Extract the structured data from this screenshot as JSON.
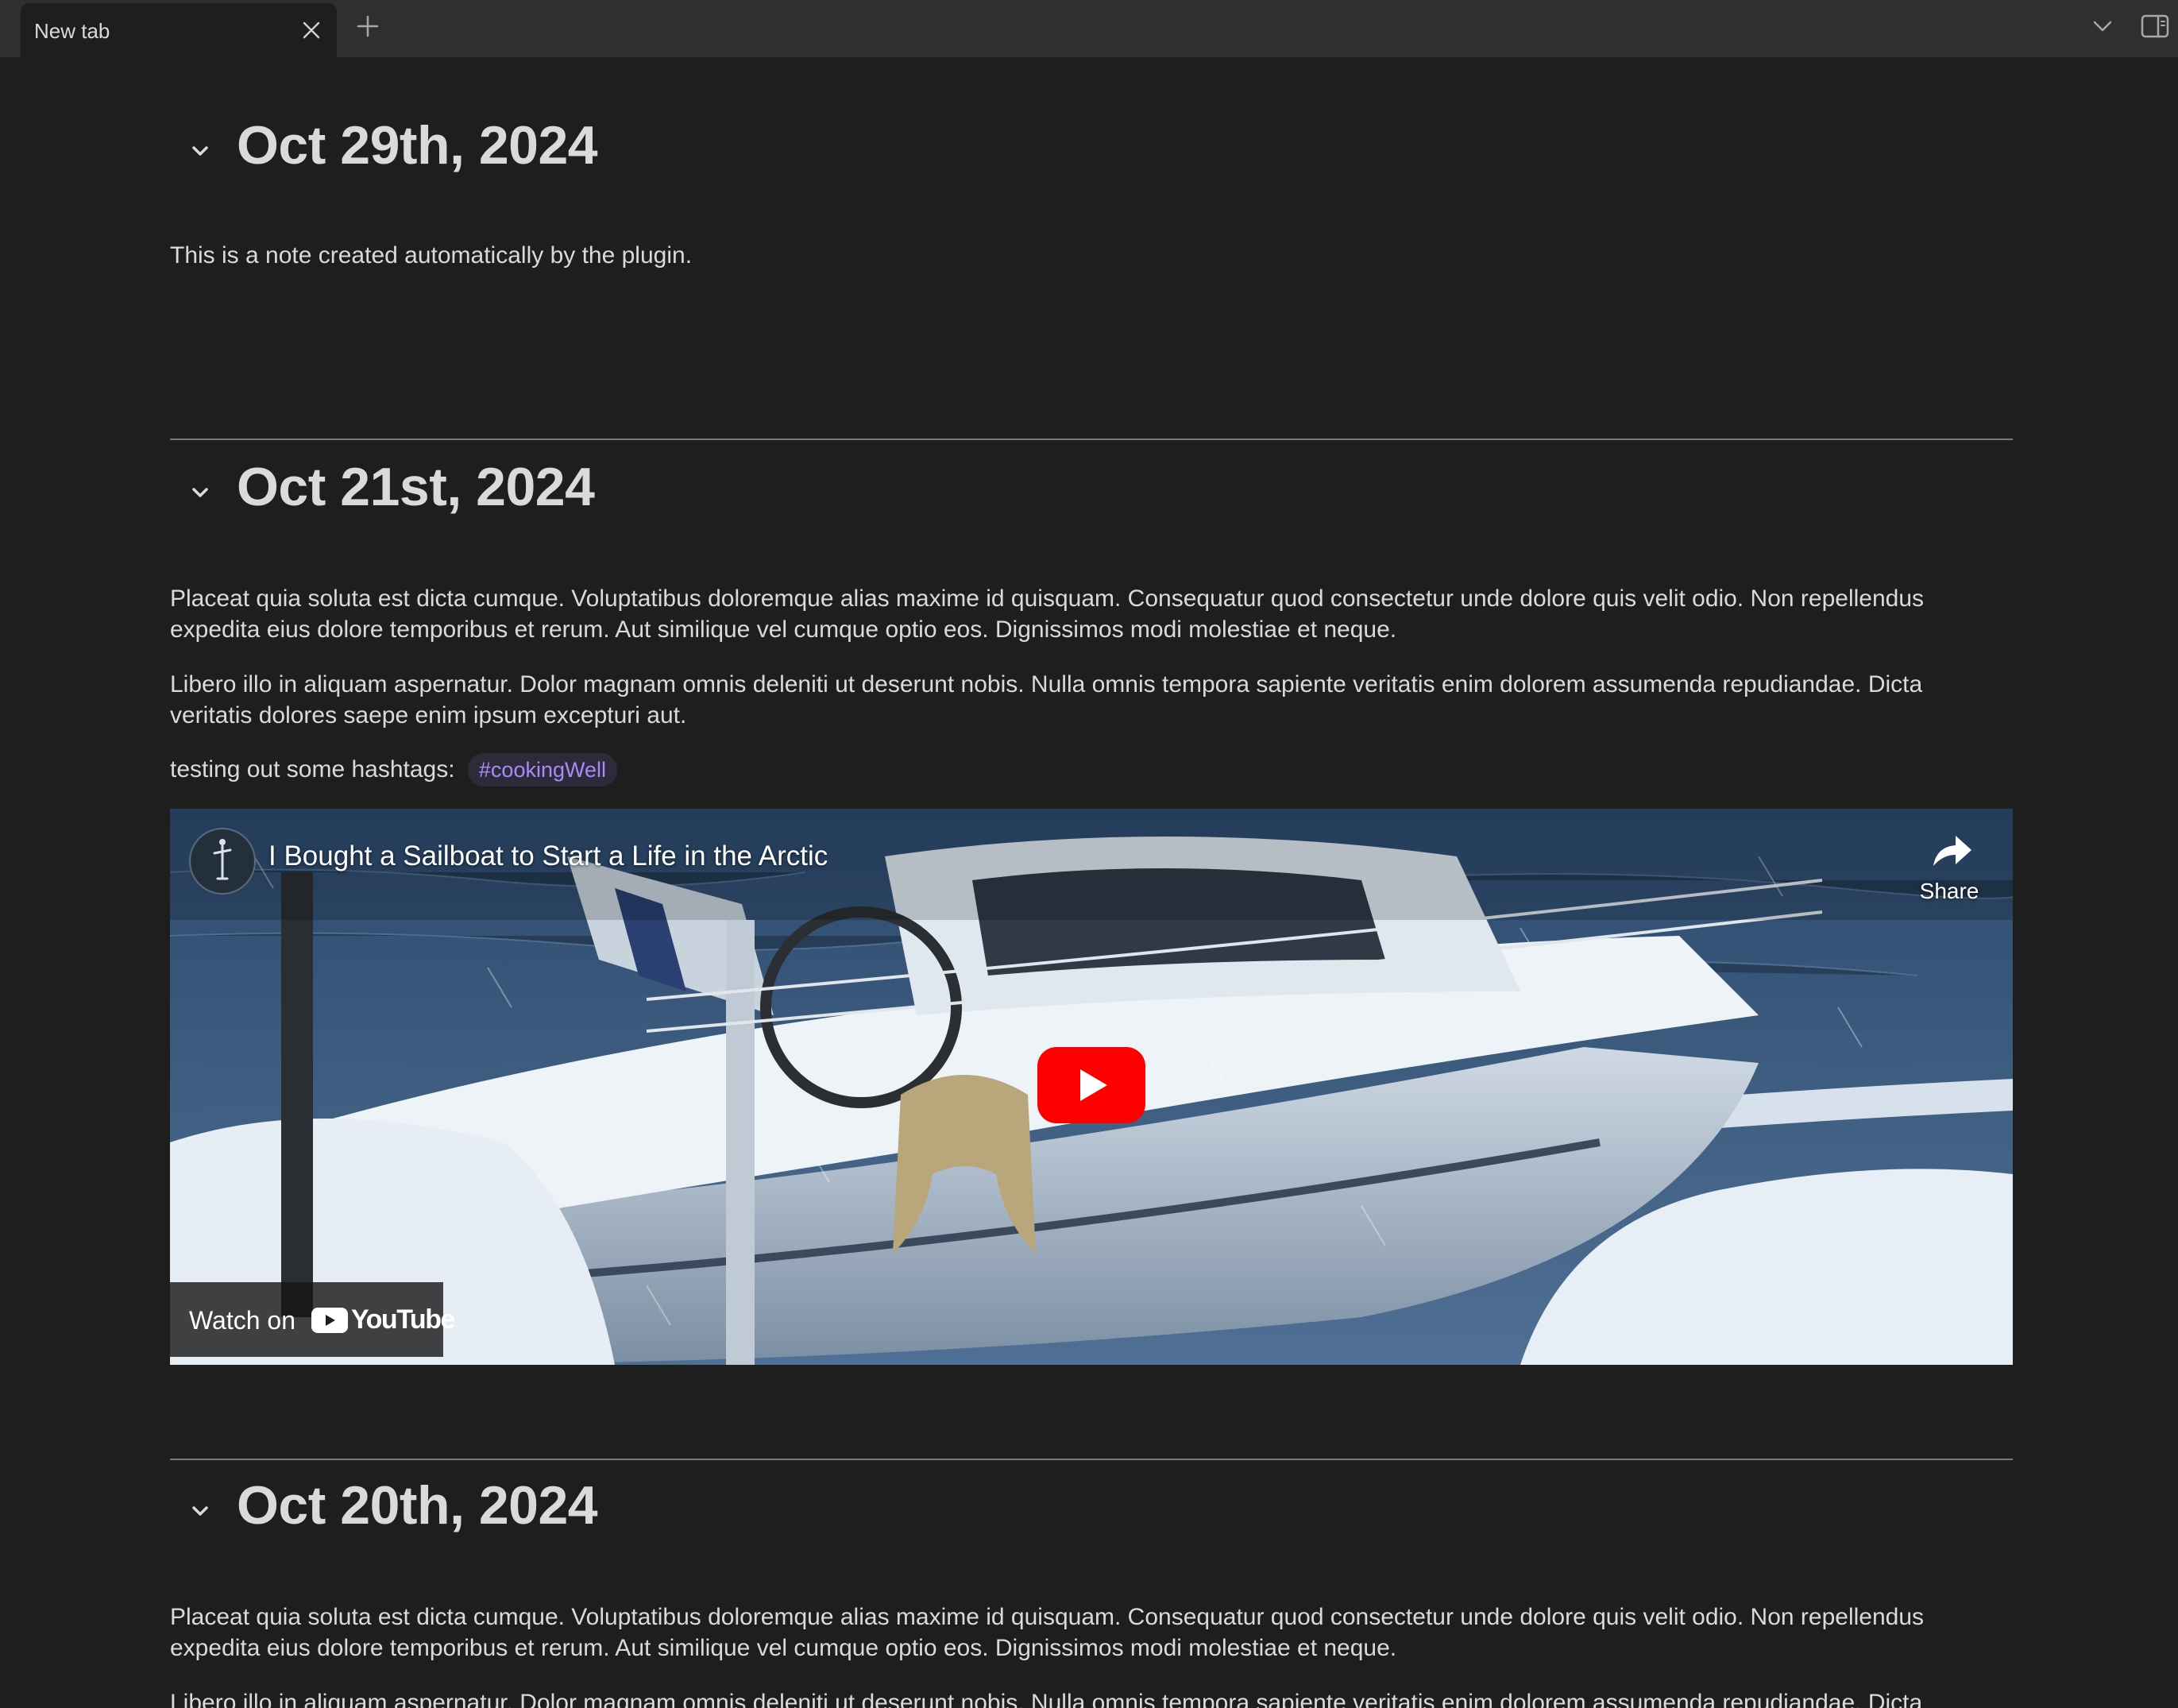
{
  "tabbar": {
    "tab_title": "New tab"
  },
  "entries": [
    {
      "date": "Oct 29th, 2024",
      "paragraphs": [
        "This is a note created automatically by the plugin."
      ]
    },
    {
      "date": "Oct 21st, 2024",
      "paragraphs": [
        "Placeat quia soluta est dicta cumque. Voluptatibus doloremque alias maxime id quisquam. Consequatur quod consectetur unde dolore quis velit odio. Non repellendus expedita eius dolore temporibus et rerum. Aut similique vel cumque optio eos. Dignissimos modi molestiae et neque.",
        "Libero illo in aliquam aspernatur. Dolor magnam omnis deleniti ut deserunt nobis. Nulla omnis tempora sapiente veritatis enim dolorem assumenda repudiandae. Dicta veritatis dolores saepe enim ipsum excepturi aut."
      ],
      "hashtag_intro": "testing out some hashtags:",
      "hashtag": "#cookingWell",
      "video": {
        "title": "I Bought a Sailboat to Start a Life in the Arctic",
        "share_label": "Share",
        "watch_on_label": "Watch on",
        "brand": "YouTube"
      }
    },
    {
      "date": "Oct 20th, 2024",
      "paragraphs": [
        "Placeat quia soluta est dicta cumque. Voluptatibus doloremque alias maxime id quisquam. Consequatur quod consectetur unde dolore quis velit odio. Non repellendus expedita eius dolore temporibus et rerum. Aut similique vel cumque optio eos. Dignissimos modi molestiae et neque.",
        "Libero illo in aliquam aspernatur. Dolor magnam omnis deleniti ut deserunt nobis. Nulla omnis tempora sapiente veritatis enim dolorem assumenda repudiandae. Dicta"
      ]
    }
  ],
  "colors": {
    "background": "#1e1e1e",
    "tabbar": "#2f2f2f",
    "text": "#dadada",
    "tag_text": "#a88bfa",
    "tag_bg": "#2d2a3a",
    "youtube_red": "#ff0000"
  }
}
